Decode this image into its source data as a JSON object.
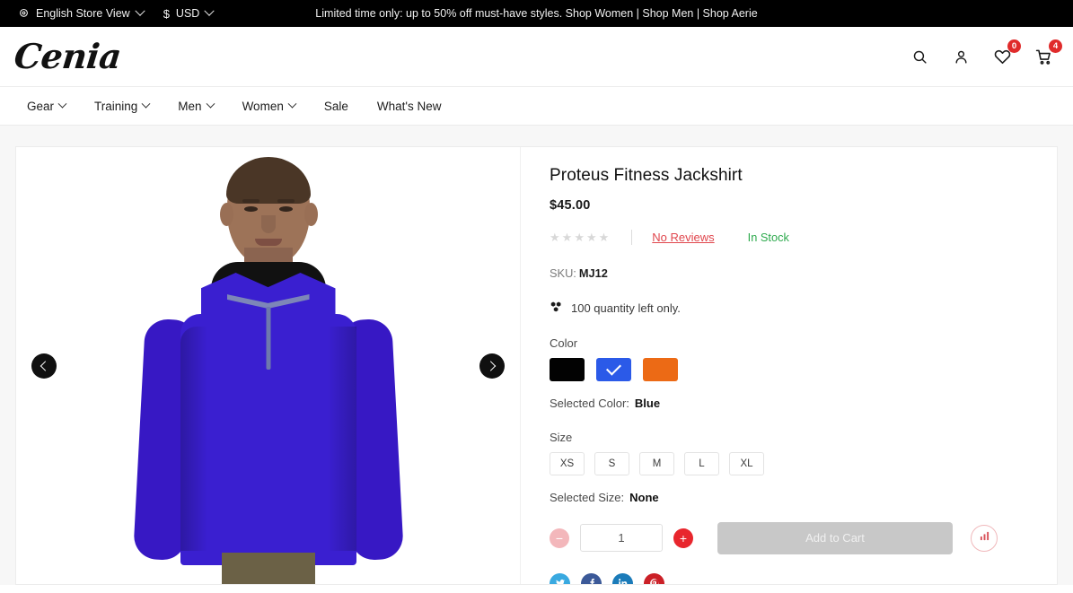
{
  "topbar": {
    "store_view": "English Store View",
    "currency_symbol": "$",
    "currency": "USD",
    "promo": "Limited time only: up to 50% off must-have styles. Shop Women | Shop Men | Shop Aerie"
  },
  "header": {
    "logo": "Cenia",
    "wishlist_count": "0",
    "cart_count": "4"
  },
  "nav": {
    "items": [
      {
        "label": "Gear",
        "has_dropdown": true
      },
      {
        "label": "Training",
        "has_dropdown": true
      },
      {
        "label": "Men",
        "has_dropdown": true
      },
      {
        "label": "Women",
        "has_dropdown": true
      },
      {
        "label": "Sale",
        "has_dropdown": false
      },
      {
        "label": "What's New",
        "has_dropdown": false
      }
    ]
  },
  "product": {
    "title": "Proteus Fitness Jackshirt",
    "price": "$45.00",
    "reviews_label": "No Reviews",
    "stock_label": "In Stock",
    "star_glyph": "★",
    "star_count": 5,
    "sku_label": "SKU:",
    "sku_value": "MJ12",
    "quantity_left": "100 quantity left only.",
    "color_label": "Color",
    "colors": [
      {
        "name": "Black",
        "hex": "#020202",
        "selected": false
      },
      {
        "name": "Blue",
        "hex": "#2b5ae8",
        "selected": true
      },
      {
        "name": "Orange",
        "hex": "#ec6a15",
        "selected": false
      }
    ],
    "selected_color_label": "Selected Color:",
    "selected_color_value": "Blue",
    "size_label": "Size",
    "sizes": [
      "XS",
      "S",
      "M",
      "L",
      "XL"
    ],
    "selected_size_label": "Selected Size:",
    "selected_size_value": "None",
    "quantity_value": "1",
    "minus_glyph": "−",
    "plus_glyph": "+",
    "add_to_cart_label": "Add to Cart",
    "socials": [
      {
        "name": "twitter",
        "hex": "#39a9e0"
      },
      {
        "name": "facebook",
        "hex": "#3b5998"
      },
      {
        "name": "linkedin",
        "hex": "#1b7bb9"
      },
      {
        "name": "pinterest",
        "hex": "#cb2027"
      }
    ]
  }
}
